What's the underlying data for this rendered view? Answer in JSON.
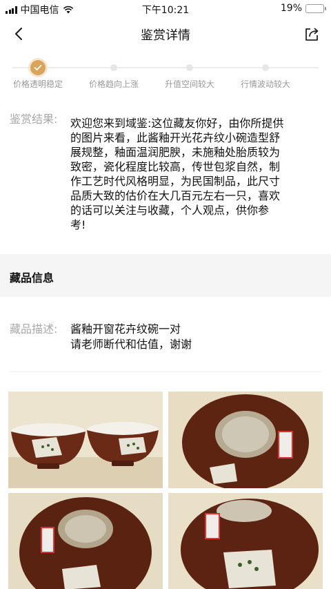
{
  "status_bar": {
    "carrier": "中国电信",
    "time": "下午10:21",
    "battery": "19%",
    "battery_level": 0.19
  },
  "nav": {
    "title": "鉴赏详情",
    "back_icon": "chevron-left-icon",
    "share_icon": "share-icon"
  },
  "steps": [
    {
      "label": "价格透明稳定",
      "active": true
    },
    {
      "label": "价格趋向上涨",
      "active": false
    },
    {
      "label": "升值空间较大",
      "active": false
    },
    {
      "label": "行情波动较大",
      "active": false
    }
  ],
  "result": {
    "label": "鉴赏结果:",
    "lines": [
      "欢迎您来到域鉴:这位藏友你好，由你所提供",
      "的图片来看，此酱釉开光花卉纹小碗造型舒",
      "展规整，釉面温润肥腴，未施釉处胎质较为",
      "致密，瓷化程度比较高，传世包浆自然，制",
      "作工艺时代风格明显，为民国制品，此尺寸",
      "品质大致的估价在大几百元左右一只，喜欢",
      "的话可以关注与收藏，个人观点，供你参",
      "考!"
    ]
  },
  "section": {
    "title": "藏品信息"
  },
  "description": {
    "label": "藏品描述:",
    "lines": [
      "酱釉开窗花卉纹碗一对",
      "请老师断代和估值，谢谢"
    ]
  },
  "colors": {
    "accent": "#d9a55b",
    "glaze_brown": "#6b2a16",
    "background_wall": "#ece4cf"
  }
}
